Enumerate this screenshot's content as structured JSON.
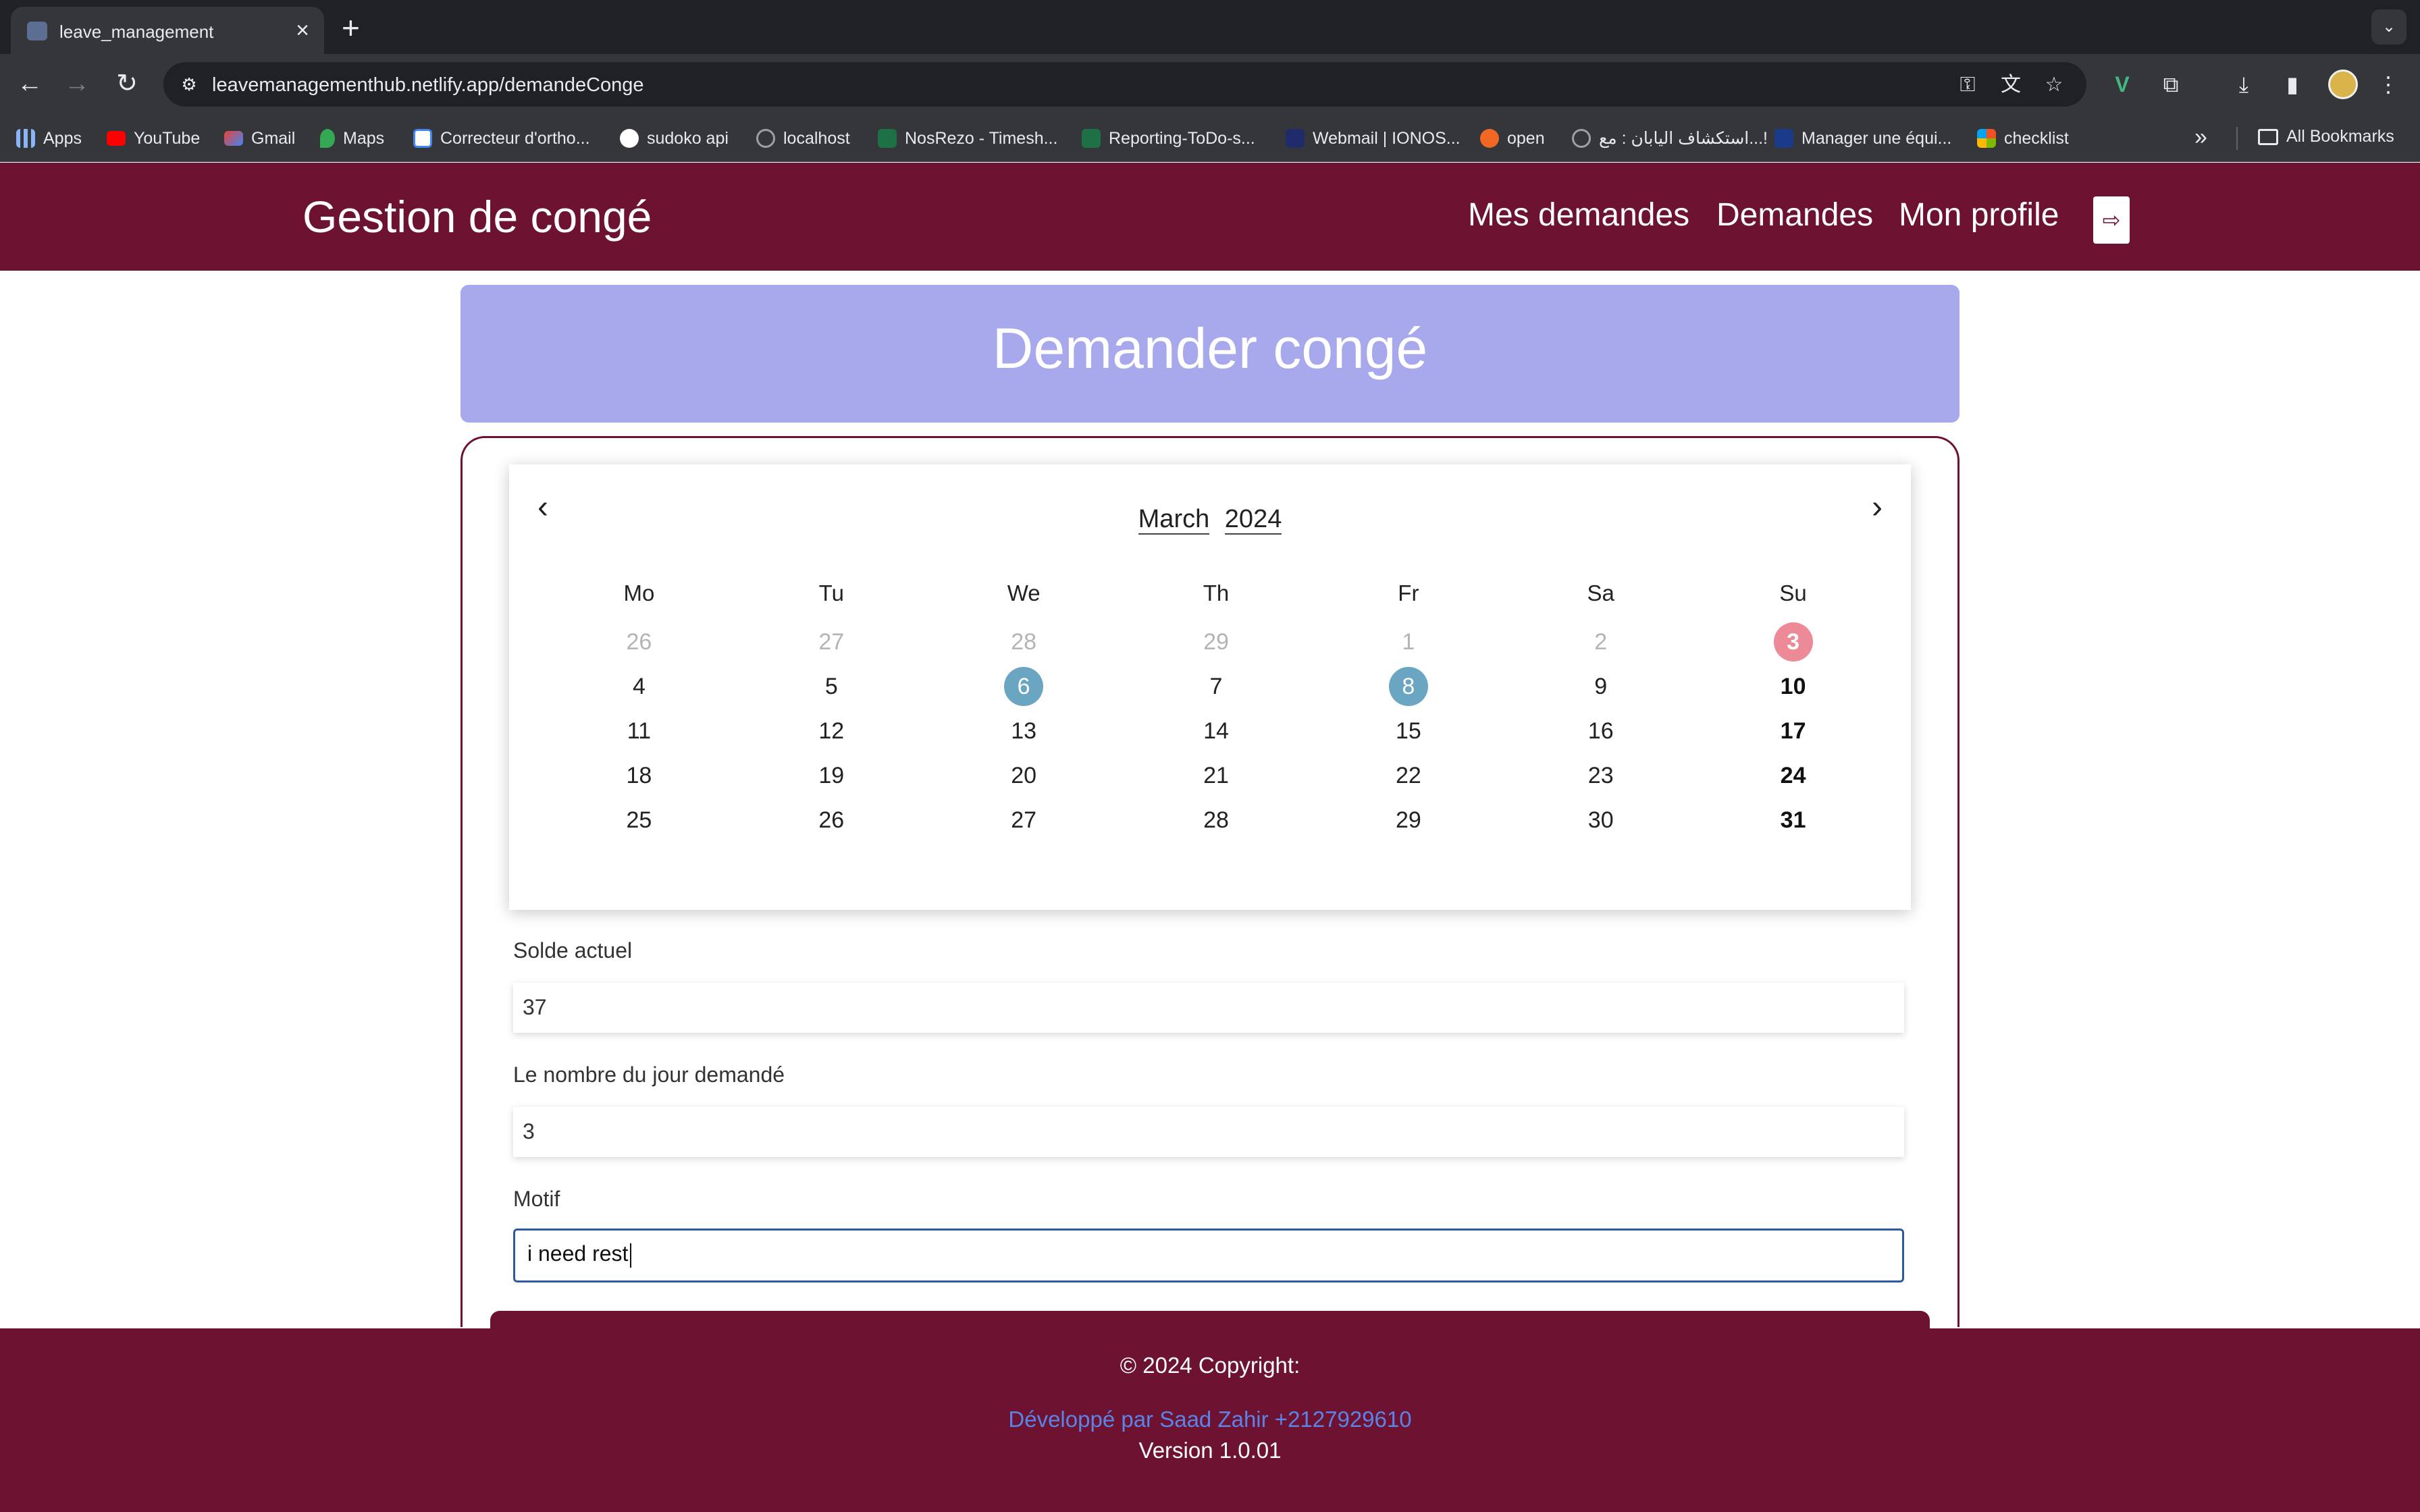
{
  "browser": {
    "tab_title": "leave_management",
    "url": "leavemanagementhub.netlify.app/demandeConge",
    "bookmarks": [
      {
        "label": "Apps",
        "icon": "apps-grid-icon",
        "color": "#8ab4f8"
      },
      {
        "label": "YouTube",
        "icon": "youtube-icon",
        "color": "#ff0000"
      },
      {
        "label": "Gmail",
        "icon": "gmail-icon",
        "color": "#ea4335"
      },
      {
        "label": "Maps",
        "icon": "maps-pin-icon",
        "color": "#34a853"
      },
      {
        "label": "Correcteur d'ortho...",
        "icon": "page-icon",
        "color": "#4285f4"
      },
      {
        "label": "sudoko api",
        "icon": "github-icon",
        "color": "#ffffff"
      },
      {
        "label": "localhost",
        "icon": "globe-icon",
        "color": "#9aa0a6"
      },
      {
        "label": "NosRezo - Timesh...",
        "icon": "excel-icon",
        "color": "#1e7145"
      },
      {
        "label": "Reporting-ToDo-s...",
        "icon": "excel-icon",
        "color": "#1e7145"
      },
      {
        "label": "Webmail | IONOS...",
        "icon": "ionos-icon",
        "color": "#1f2b6b"
      },
      {
        "label": "open",
        "icon": "ask-icon",
        "color": "#f26722"
      },
      {
        "label": "استكشاف اليابان : مع...!",
        "icon": "globe-icon",
        "color": "#9aa0a6"
      },
      {
        "label": "Manager une équi...",
        "icon": "mp-icon",
        "color": "#1a3a8a"
      },
      {
        "label": "checklist",
        "icon": "microsoft-icon",
        "color": "#f25022"
      }
    ],
    "all_bookmarks": "All Bookmarks"
  },
  "header": {
    "brand": "Gestion de congé",
    "nav": [
      "Mes demandes",
      "Demandes",
      "Mon profile"
    ],
    "logout_icon": "logout-icon"
  },
  "page": {
    "title": "Demander congé"
  },
  "calendar": {
    "month": "March",
    "year": "2024",
    "weekdays": [
      "Mo",
      "Tu",
      "We",
      "Th",
      "Fr",
      "Sa",
      "Su"
    ],
    "weeks": [
      [
        {
          "d": "26",
          "muted": true
        },
        {
          "d": "27",
          "muted": true
        },
        {
          "d": "28",
          "muted": true
        },
        {
          "d": "29",
          "muted": true
        },
        {
          "d": "1",
          "muted": true
        },
        {
          "d": "2",
          "muted": true
        },
        {
          "d": "3",
          "today": true
        }
      ],
      [
        {
          "d": "4"
        },
        {
          "d": "5"
        },
        {
          "d": "6",
          "range_start": true
        },
        {
          "d": "7",
          "in_range": true
        },
        {
          "d": "8",
          "range_end": true
        },
        {
          "d": "9"
        },
        {
          "d": "10"
        }
      ],
      [
        {
          "d": "11"
        },
        {
          "d": "12"
        },
        {
          "d": "13"
        },
        {
          "d": "14"
        },
        {
          "d": "15"
        },
        {
          "d": "16"
        },
        {
          "d": "17"
        }
      ],
      [
        {
          "d": "18"
        },
        {
          "d": "19"
        },
        {
          "d": "20"
        },
        {
          "d": "21"
        },
        {
          "d": "22"
        },
        {
          "d": "23"
        },
        {
          "d": "24"
        }
      ],
      [
        {
          "d": "25"
        },
        {
          "d": "26"
        },
        {
          "d": "27"
        },
        {
          "d": "28"
        },
        {
          "d": "29"
        },
        {
          "d": "30"
        },
        {
          "d": "31"
        }
      ]
    ],
    "colors": {
      "today": "#ec8a98",
      "range_end": "#6aa6c2",
      "range_fill": "#a6d6e7"
    }
  },
  "form": {
    "solde_label": "Solde actuel",
    "solde_value": "37",
    "days_label": "Le nombre du jour demandé",
    "days_value": "3",
    "motif_label": "Motif",
    "motif_value": "i need rest"
  },
  "footer": {
    "copyright": "© 2024 Copyright:",
    "developer": "Développé par Saad Zahir +2127929610",
    "version": "Version 1.0.01"
  },
  "theme": {
    "primary": "#6d1230",
    "banner": "#a8a8ec",
    "link": "#5a84e8"
  }
}
